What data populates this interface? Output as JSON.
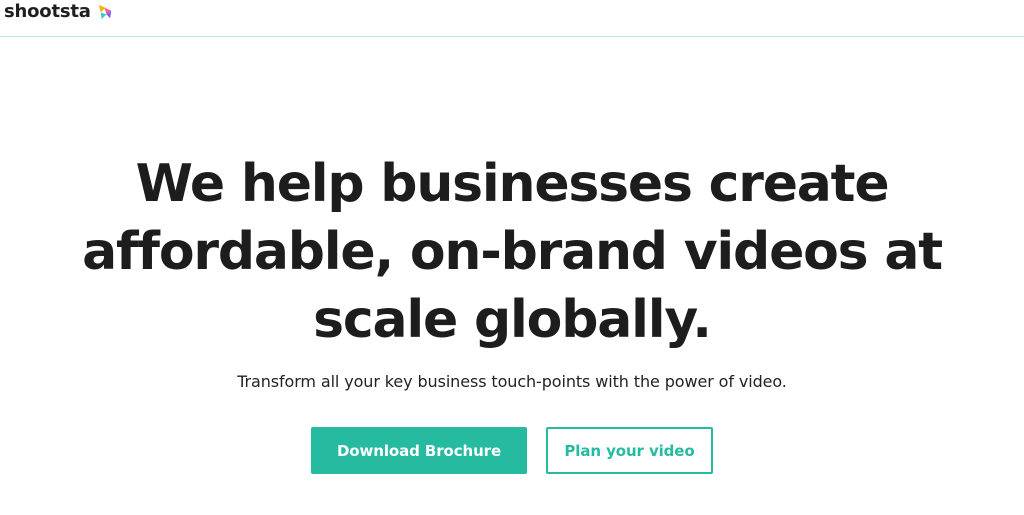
{
  "header": {
    "logo_text": "shootsta",
    "logo_icon": "shootsta-logo-icon",
    "brand_colors": [
      "#f5b700",
      "#ff5d8f",
      "#3ec9c2",
      "#7a5cff"
    ]
  },
  "hero": {
    "headline": "We help businesses create affordable, on-brand videos at scale globally.",
    "subtext": "Transform all your key business touch-points with the power of video."
  },
  "actions": {
    "download_label": "Download Brochure",
    "plan_label": "Plan your video"
  },
  "colors": {
    "accent": "#26bba0",
    "divider": "#bfe7da",
    "text": "#1d1d1d"
  }
}
